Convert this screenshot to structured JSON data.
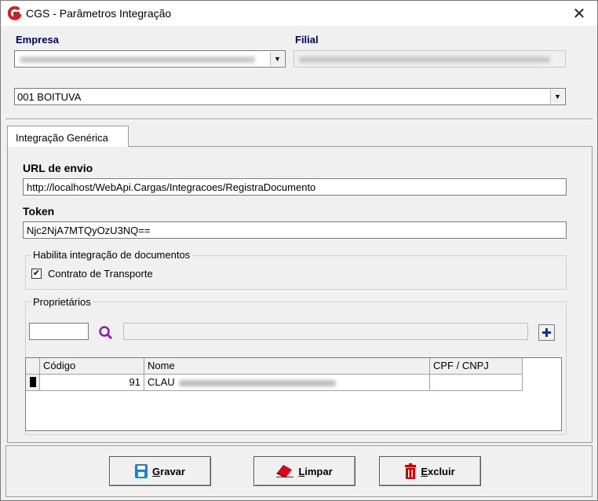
{
  "window": {
    "title": "CGS - Parâmetros Integração",
    "close_glyph": "✕"
  },
  "empresa": {
    "label": "Empresa",
    "value": "001 BOITUVA"
  },
  "filial": {
    "label": "Filial"
  },
  "tabs": [
    {
      "label": "Integração Genérica"
    }
  ],
  "url": {
    "label": "URL de envio",
    "value": "http://localhost/WebApi.Cargas/Integracoes/RegistraDocumento"
  },
  "token": {
    "label": "Token",
    "value": "Njc2NjA7MTQyOzU3NQ=="
  },
  "habilita": {
    "title": "Habilita integração de documentos",
    "contrato_label": "Contrato de Transporte",
    "contrato_checked": true,
    "check_glyph": "✔"
  },
  "proprietarios": {
    "title": "Proprietários",
    "columns": [
      "Código",
      "Nome",
      "CPF / CNPJ"
    ],
    "rows": [
      {
        "codigo": "91",
        "nome": "CLAU",
        "cpf": ""
      }
    ]
  },
  "buttons": {
    "gravar_first": "G",
    "gravar_rest": "ravar",
    "limpar_first": "L",
    "limpar_rest": "impar",
    "excluir_first": "E",
    "excluir_rest": "xcluir"
  },
  "colors": {
    "title_icon": "#d32027",
    "label_blue": "#00006e",
    "search_icon": "#8b1fa8",
    "add_icon": "#1a2aa0",
    "save_icon": "#1e7fd8",
    "eraser_icon": "#e0001b",
    "delete_icon": "#d10000"
  }
}
